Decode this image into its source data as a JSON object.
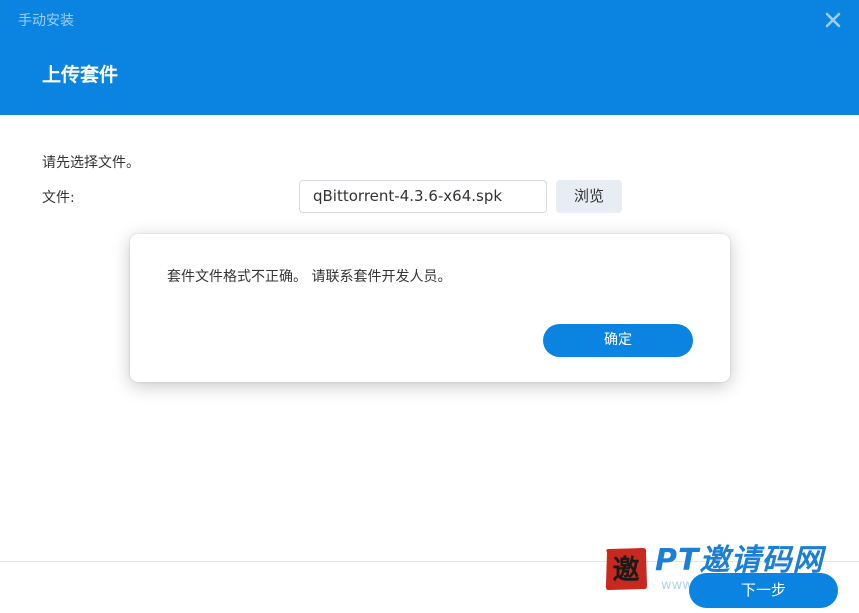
{
  "window": {
    "title": "手动安装",
    "close_icon": "close-icon"
  },
  "header": {
    "title": "上传套件",
    "color": "#0a84e0"
  },
  "form": {
    "instruction": "请先选择文件。",
    "file_label": "文件:",
    "file_value": "qBittorrent-4.3.6-x64.spk",
    "browse_label": "浏览"
  },
  "dialog": {
    "message": "套件文件格式不正确。 请联系套件开发人员。",
    "ok_label": "确定"
  },
  "footer": {
    "next_label": "下一步"
  },
  "watermark": {
    "seal_char": "邀",
    "text": "PT邀请码网",
    "url": "www.ptyqm.com"
  }
}
